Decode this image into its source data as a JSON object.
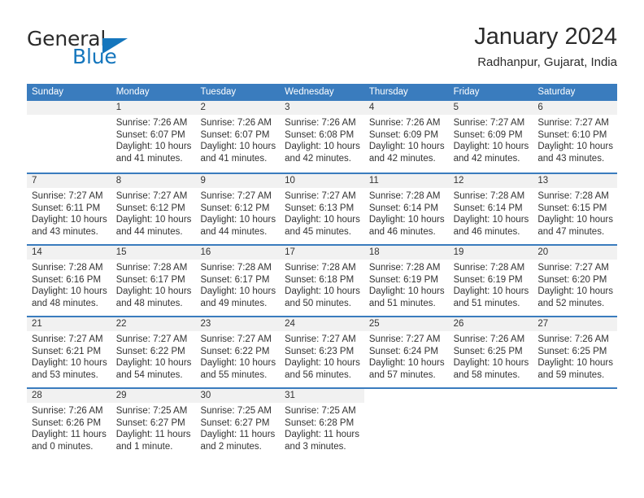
{
  "brand": {
    "word1": "General",
    "word2": "Blue",
    "accent_color": "#1576bd",
    "triangle_icon": "brand-triangle-icon"
  },
  "header": {
    "title": "January 2024",
    "subtitle": "Radhanpur, Gujarat, India"
  },
  "calendar": {
    "header_bg": "#3a7cbe",
    "day_band_bg": "#f1f1f1",
    "weekday_headers": [
      "Sunday",
      "Monday",
      "Tuesday",
      "Wednesday",
      "Thursday",
      "Friday",
      "Saturday"
    ],
    "weeks": [
      [
        {
          "day": "",
          "lines": [],
          "state": "empty"
        },
        {
          "day": "1",
          "lines": [
            "Sunrise: 7:26 AM",
            "Sunset: 6:07 PM",
            "Daylight: 10 hours",
            "and 41 minutes."
          ],
          "state": "filled"
        },
        {
          "day": "2",
          "lines": [
            "Sunrise: 7:26 AM",
            "Sunset: 6:07 PM",
            "Daylight: 10 hours",
            "and 41 minutes."
          ],
          "state": "filled"
        },
        {
          "day": "3",
          "lines": [
            "Sunrise: 7:26 AM",
            "Sunset: 6:08 PM",
            "Daylight: 10 hours",
            "and 42 minutes."
          ],
          "state": "filled"
        },
        {
          "day": "4",
          "lines": [
            "Sunrise: 7:26 AM",
            "Sunset: 6:09 PM",
            "Daylight: 10 hours",
            "and 42 minutes."
          ],
          "state": "filled"
        },
        {
          "day": "5",
          "lines": [
            "Sunrise: 7:27 AM",
            "Sunset: 6:09 PM",
            "Daylight: 10 hours",
            "and 42 minutes."
          ],
          "state": "filled"
        },
        {
          "day": "6",
          "lines": [
            "Sunrise: 7:27 AM",
            "Sunset: 6:10 PM",
            "Daylight: 10 hours",
            "and 43 minutes."
          ],
          "state": "filled"
        }
      ],
      [
        {
          "day": "7",
          "lines": [
            "Sunrise: 7:27 AM",
            "Sunset: 6:11 PM",
            "Daylight: 10 hours",
            "and 43 minutes."
          ],
          "state": "filled"
        },
        {
          "day": "8",
          "lines": [
            "Sunrise: 7:27 AM",
            "Sunset: 6:12 PM",
            "Daylight: 10 hours",
            "and 44 minutes."
          ],
          "state": "filled"
        },
        {
          "day": "9",
          "lines": [
            "Sunrise: 7:27 AM",
            "Sunset: 6:12 PM",
            "Daylight: 10 hours",
            "and 44 minutes."
          ],
          "state": "filled"
        },
        {
          "day": "10",
          "lines": [
            "Sunrise: 7:27 AM",
            "Sunset: 6:13 PM",
            "Daylight: 10 hours",
            "and 45 minutes."
          ],
          "state": "filled"
        },
        {
          "day": "11",
          "lines": [
            "Sunrise: 7:28 AM",
            "Sunset: 6:14 PM",
            "Daylight: 10 hours",
            "and 46 minutes."
          ],
          "state": "filled"
        },
        {
          "day": "12",
          "lines": [
            "Sunrise: 7:28 AM",
            "Sunset: 6:14 PM",
            "Daylight: 10 hours",
            "and 46 minutes."
          ],
          "state": "filled"
        },
        {
          "day": "13",
          "lines": [
            "Sunrise: 7:28 AM",
            "Sunset: 6:15 PM",
            "Daylight: 10 hours",
            "and 47 minutes."
          ],
          "state": "filled"
        }
      ],
      [
        {
          "day": "14",
          "lines": [
            "Sunrise: 7:28 AM",
            "Sunset: 6:16 PM",
            "Daylight: 10 hours",
            "and 48 minutes."
          ],
          "state": "filled"
        },
        {
          "day": "15",
          "lines": [
            "Sunrise: 7:28 AM",
            "Sunset: 6:17 PM",
            "Daylight: 10 hours",
            "and 48 minutes."
          ],
          "state": "filled"
        },
        {
          "day": "16",
          "lines": [
            "Sunrise: 7:28 AM",
            "Sunset: 6:17 PM",
            "Daylight: 10 hours",
            "and 49 minutes."
          ],
          "state": "filled"
        },
        {
          "day": "17",
          "lines": [
            "Sunrise: 7:28 AM",
            "Sunset: 6:18 PM",
            "Daylight: 10 hours",
            "and 50 minutes."
          ],
          "state": "filled"
        },
        {
          "day": "18",
          "lines": [
            "Sunrise: 7:28 AM",
            "Sunset: 6:19 PM",
            "Daylight: 10 hours",
            "and 51 minutes."
          ],
          "state": "filled"
        },
        {
          "day": "19",
          "lines": [
            "Sunrise: 7:28 AM",
            "Sunset: 6:19 PM",
            "Daylight: 10 hours",
            "and 51 minutes."
          ],
          "state": "filled"
        },
        {
          "day": "20",
          "lines": [
            "Sunrise: 7:27 AM",
            "Sunset: 6:20 PM",
            "Daylight: 10 hours",
            "and 52 minutes."
          ],
          "state": "filled"
        }
      ],
      [
        {
          "day": "21",
          "lines": [
            "Sunrise: 7:27 AM",
            "Sunset: 6:21 PM",
            "Daylight: 10 hours",
            "and 53 minutes."
          ],
          "state": "filled"
        },
        {
          "day": "22",
          "lines": [
            "Sunrise: 7:27 AM",
            "Sunset: 6:22 PM",
            "Daylight: 10 hours",
            "and 54 minutes."
          ],
          "state": "filled"
        },
        {
          "day": "23",
          "lines": [
            "Sunrise: 7:27 AM",
            "Sunset: 6:22 PM",
            "Daylight: 10 hours",
            "and 55 minutes."
          ],
          "state": "filled"
        },
        {
          "day": "24",
          "lines": [
            "Sunrise: 7:27 AM",
            "Sunset: 6:23 PM",
            "Daylight: 10 hours",
            "and 56 minutes."
          ],
          "state": "filled"
        },
        {
          "day": "25",
          "lines": [
            "Sunrise: 7:27 AM",
            "Sunset: 6:24 PM",
            "Daylight: 10 hours",
            "and 57 minutes."
          ],
          "state": "filled"
        },
        {
          "day": "26",
          "lines": [
            "Sunrise: 7:26 AM",
            "Sunset: 6:25 PM",
            "Daylight: 10 hours",
            "and 58 minutes."
          ],
          "state": "filled"
        },
        {
          "day": "27",
          "lines": [
            "Sunrise: 7:26 AM",
            "Sunset: 6:25 PM",
            "Daylight: 10 hours",
            "and 59 minutes."
          ],
          "state": "filled"
        }
      ],
      [
        {
          "day": "28",
          "lines": [
            "Sunrise: 7:26 AM",
            "Sunset: 6:26 PM",
            "Daylight: 11 hours",
            "and 0 minutes."
          ],
          "state": "filled"
        },
        {
          "day": "29",
          "lines": [
            "Sunrise: 7:25 AM",
            "Sunset: 6:27 PM",
            "Daylight: 11 hours",
            "and 1 minute."
          ],
          "state": "filled"
        },
        {
          "day": "30",
          "lines": [
            "Sunrise: 7:25 AM",
            "Sunset: 6:27 PM",
            "Daylight: 11 hours",
            "and 2 minutes."
          ],
          "state": "filled"
        },
        {
          "day": "31",
          "lines": [
            "Sunrise: 7:25 AM",
            "Sunset: 6:28 PM",
            "Daylight: 11 hours",
            "and 3 minutes."
          ],
          "state": "filled"
        },
        {
          "day": "",
          "lines": [],
          "state": "blank"
        },
        {
          "day": "",
          "lines": [],
          "state": "blank"
        },
        {
          "day": "",
          "lines": [],
          "state": "blank"
        }
      ]
    ]
  }
}
